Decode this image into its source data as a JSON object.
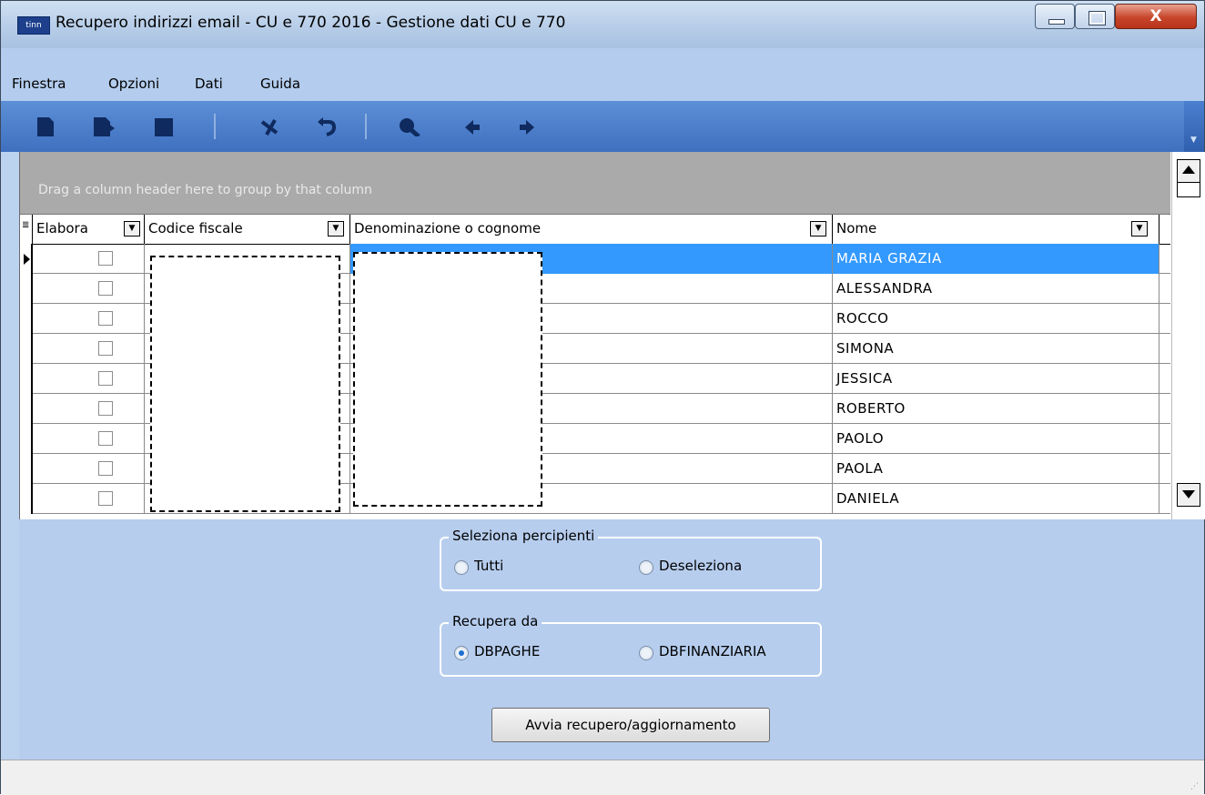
{
  "window": {
    "title": "Recupero indirizzi email - CU e 770 2016 - Gestione dati CU e 770",
    "app_icon_text": "tinn",
    "controls": {
      "minimize_icon": "minimize-icon",
      "maximize_icon": "maximize-icon",
      "close_icon": "close-icon",
      "close_glyph": "X"
    }
  },
  "menu": {
    "items": [
      "Finestra",
      "Opzioni",
      "Dati",
      "Guida"
    ]
  },
  "toolbar": {
    "icons": [
      "new-doc-icon",
      "save-doc-icon",
      "stop-icon",
      "delete-icon",
      "undo-icon",
      "search-icon",
      "back-arrow-icon",
      "forward-arrow-icon"
    ]
  },
  "grid": {
    "group_panel_text": "Drag a column header here to group by that column",
    "columns": [
      "Elabora",
      "Codice fiscale",
      "Denominazione o cognome",
      "Nome"
    ],
    "rows": [
      {
        "elabora": false,
        "codice_fiscale": "",
        "denominazione": "",
        "nome": "MARIA GRAZIA",
        "selected": true
      },
      {
        "elabora": false,
        "codice_fiscale": "",
        "denominazione": "",
        "nome": "ALESSANDRA"
      },
      {
        "elabora": false,
        "codice_fiscale": "",
        "denominazione": "",
        "nome": "ROCCO"
      },
      {
        "elabora": false,
        "codice_fiscale": "",
        "denominazione": "",
        "nome": "SIMONA"
      },
      {
        "elabora": false,
        "codice_fiscale": "",
        "denominazione": "",
        "nome": "JESSICA"
      },
      {
        "elabora": false,
        "codice_fiscale": "",
        "denominazione": "",
        "nome": "ROBERTO"
      },
      {
        "elabora": false,
        "codice_fiscale": "",
        "denominazione": "",
        "nome": "PAOLO"
      },
      {
        "elabora": false,
        "codice_fiscale": "",
        "denominazione": "",
        "nome": "PAOLA"
      },
      {
        "elabora": false,
        "codice_fiscale": "",
        "denominazione": "",
        "nome": "DANIELA"
      }
    ]
  },
  "seleziona": {
    "title": "Seleziona percipienti",
    "options": [
      "Tutti",
      "Deseleziona"
    ],
    "selected": null
  },
  "recupera": {
    "title": "Recupera da",
    "options": [
      "DBPAGHE",
      "DBFINANZIARIA"
    ],
    "selected": "DBPAGHE"
  },
  "action_button": "Avvia recupero/aggiornamento",
  "colors": {
    "selection": "#3399ff",
    "toolbar": "#4a7cc8",
    "panel": "#b6cdee",
    "group_panel": "#aaaaaa"
  }
}
